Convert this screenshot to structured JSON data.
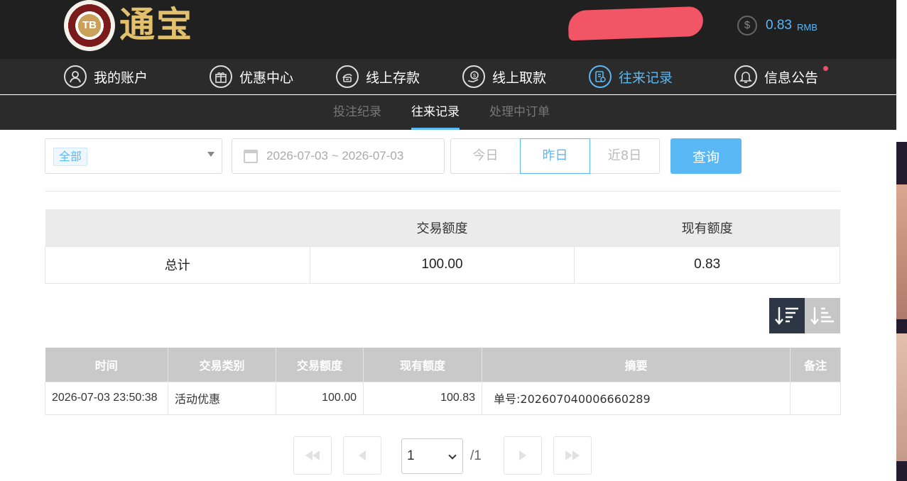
{
  "header": {
    "logo_badge": "TB",
    "logo_name": "通宝",
    "balance_amount": "0.83",
    "balance_unit": "RMB",
    "icons": {
      "balance": "dollar-coin-icon"
    }
  },
  "nav": {
    "items": [
      {
        "label": "我的账户",
        "icon": "user-icon",
        "active": false
      },
      {
        "label": "优惠中心",
        "icon": "gift-icon",
        "active": false
      },
      {
        "label": "线上存款",
        "icon": "deposit-icon",
        "active": false
      },
      {
        "label": "线上取款",
        "icon": "withdraw-icon",
        "active": false
      },
      {
        "label": "往来记录",
        "icon": "records-icon",
        "active": true
      },
      {
        "label": "信息公告",
        "icon": "bell-icon",
        "active": false
      }
    ]
  },
  "subnav": {
    "tabs": [
      {
        "label": "投注纪录",
        "active": false
      },
      {
        "label": "往来记录",
        "active": true
      },
      {
        "label": "处理中订单",
        "active": false
      }
    ]
  },
  "filters": {
    "type_selected": "全部",
    "date_range": "2026-07-03 ~ 2026-07-03",
    "quick": [
      {
        "label": "今日",
        "active": false
      },
      {
        "label": "昨日",
        "active": true
      },
      {
        "label": "近8日",
        "active": false
      }
    ],
    "query_label": "查询"
  },
  "summary": {
    "headers": [
      "",
      "交易额度",
      "现有额度"
    ],
    "row": {
      "label": "总计",
      "amount": "100.00",
      "balance": "0.83"
    }
  },
  "records": {
    "headers": [
      "时间",
      "交易类别",
      "交易额度",
      "现有额度",
      "摘要",
      "备注"
    ],
    "rows": [
      {
        "time": "2026-07-03 23:50:38",
        "category": "活动优惠",
        "amount": "100.00",
        "balance": "100.83",
        "summary": "单号:202607040006660289",
        "remark": ""
      }
    ]
  },
  "pagination": {
    "current": "1",
    "total": "/1"
  },
  "colors": {
    "accent": "#5ab8f5",
    "header_bg": "#202020",
    "nav_bg": "#2b2b2b",
    "redaction": "#f25565",
    "table_header": "#c9c9c9"
  }
}
